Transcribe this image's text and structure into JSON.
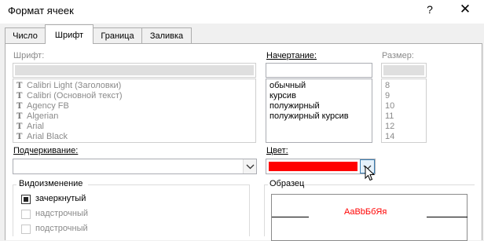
{
  "window": {
    "title": "Формат ячеек",
    "help_glyph": "?",
    "close_glyph": "✕"
  },
  "tabs": [
    {
      "label": "Число",
      "active": false
    },
    {
      "label": "Шрифт",
      "active": true
    },
    {
      "label": "Граница",
      "active": false
    },
    {
      "label": "Заливка",
      "active": false
    }
  ],
  "font": {
    "label": "Шрифт:",
    "value": "",
    "icon": "truetype-font-icon",
    "items": [
      "Calibri Light (Заголовки)",
      "Calibri (Основной текст)",
      "Agency FB",
      "Algerian",
      "Arial",
      "Arial Black"
    ]
  },
  "style": {
    "label": "Начертание:",
    "value": "",
    "items": [
      "обычный",
      "курсив",
      "полужирный",
      "полужирный курсив"
    ]
  },
  "size": {
    "label": "Размер:",
    "value": "",
    "items": [
      "8",
      "9",
      "10",
      "11",
      "12",
      "14"
    ]
  },
  "underline": {
    "label": "Подчеркивание:",
    "value": ""
  },
  "color": {
    "label": "Цвет:",
    "value_color": "#ff0000"
  },
  "effects": {
    "label": "Видоизменение",
    "items": [
      {
        "label": "зачеркнутый",
        "enabled": true,
        "checked": "indeterminate"
      },
      {
        "label": "надстрочный",
        "enabled": false,
        "checked": false
      },
      {
        "label": "подстрочный",
        "enabled": false,
        "checked": false
      }
    ]
  },
  "preview": {
    "label": "Образец",
    "text": "AaBbБбЯя",
    "text_color": "#ff0000"
  }
}
